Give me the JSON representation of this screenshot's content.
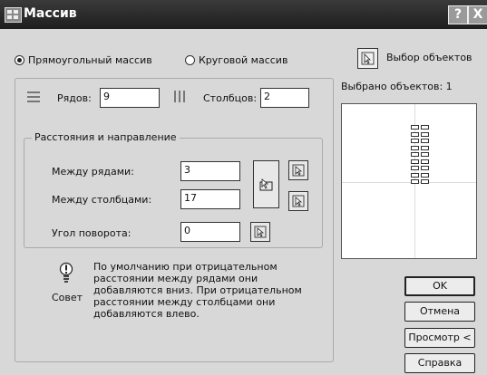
{
  "window": {
    "title": "Массив",
    "help_glyph": "?",
    "close_glyph": "X"
  },
  "mode": {
    "rect_label": "Прямоугольный массив",
    "polar_label": "Круговой массив",
    "selected": "rect"
  },
  "rows": {
    "label": "Рядов:",
    "value": "9"
  },
  "cols": {
    "label": "Столбцов:",
    "value": "2"
  },
  "offset_group": {
    "legend": "Расстояния и направление",
    "row_offset_label": "Между рядами:",
    "row_offset_value": "3",
    "col_offset_label": "Между столбцами:",
    "col_offset_value": "17",
    "angle_label": "Угол поворота:",
    "angle_value": "0"
  },
  "tip": {
    "label": "Совет",
    "text": "По умолчанию при отрицательном расстоянии между рядами они добавляются вниз. При отрицательном расстоянии между столбцами они добавляются влево."
  },
  "selection": {
    "select_label": "Выбор объектов",
    "count_label": "Выбрано объектов: 1"
  },
  "buttons": {
    "ok": "OK",
    "cancel": "Отмена",
    "preview": "Просмотр <",
    "help": "Справка"
  }
}
